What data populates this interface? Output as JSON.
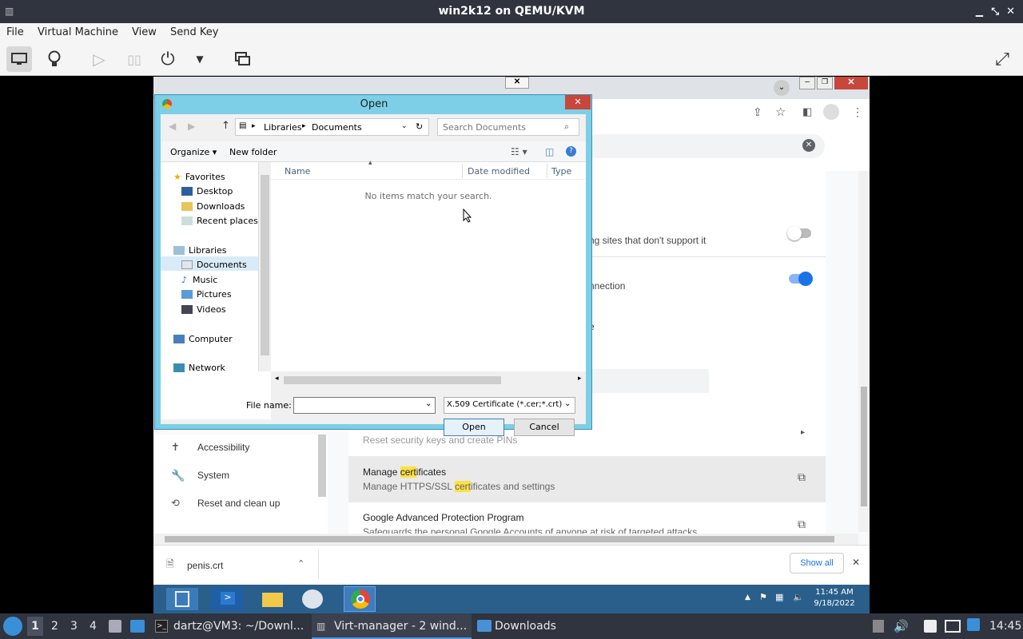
{
  "host": {
    "title": "win2k12 on QEMU/KVM",
    "menu": [
      "File",
      "Virtual Machine",
      "View",
      "Send Key"
    ]
  },
  "chrome": {
    "settings_rows": [
      {
        "text": "ng sites that don't support it"
      },
      {
        "text": "nnection"
      },
      {
        "text": "e"
      }
    ],
    "sidebar": [
      "Accessibility",
      "System",
      "Reset and clean up"
    ],
    "security_key_text": "Reset security keys and create PINs",
    "manage_certs_title_pre": "Manage ",
    "manage_certs_title_hl": "cert",
    "manage_certs_title_post": "ificates",
    "manage_certs_desc_pre": "Manage HTTPS/SSL ",
    "manage_certs_desc_hl": "cert",
    "manage_certs_desc_post": "ificates and settings",
    "gapp_title": "Google Advanced Protection Program",
    "gapp_desc": "Safeguards the personal Google Accounts of anyone at risk of targeted attacks",
    "download_file": "penis.crt",
    "show_all": "Show all"
  },
  "dialog": {
    "title": "Open",
    "breadcrumb": [
      "Libraries",
      "Documents"
    ],
    "search_placeholder": "Search Documents",
    "organize": "Organize",
    "new_folder": "New folder",
    "columns": [
      "Name",
      "Date modified",
      "Type"
    ],
    "empty_message": "No items match your search.",
    "favorites": "Favorites",
    "favorites_items": [
      "Desktop",
      "Downloads",
      "Recent places"
    ],
    "libraries": "Libraries",
    "libraries_items": [
      "Documents",
      "Music",
      "Pictures",
      "Videos"
    ],
    "computer": "Computer",
    "network": "Network",
    "file_name_label": "File name:",
    "file_name_value": "",
    "filter": "X.509 Certificate (*.cer;*.crt)",
    "open": "Open",
    "cancel": "Cancel"
  },
  "win_taskbar": {
    "time": "11:45 AM",
    "date": "9/18/2022"
  },
  "xfce": {
    "workspaces": [
      "1",
      "2",
      "3",
      "4"
    ],
    "tasks": [
      "dartz@VM3: ~/Downl...",
      "Virt-manager - 2 wind...",
      "Downloads"
    ],
    "clock": "14:45"
  }
}
